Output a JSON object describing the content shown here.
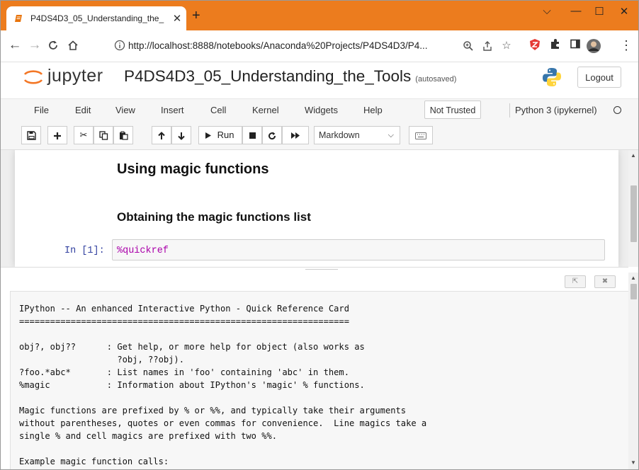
{
  "browser": {
    "tab_title": "P4DS4D3_05_Understanding_the_",
    "new_tab_symbol": "+",
    "url": "http://localhost:8888/notebooks/Anaconda%20Projects/P4DS4D3/P4...",
    "window_controls": [
      "⌵",
      "—",
      "☐",
      "✕"
    ]
  },
  "jupyter": {
    "logo_text": "jupyter",
    "notebook_title": "P4DS4D3_05_Understanding_the_Tools",
    "save_status": "(autosaved)",
    "logout_label": "Logout",
    "menus": [
      "File",
      "Edit",
      "View",
      "Insert",
      "Cell",
      "Kernel",
      "Widgets",
      "Help"
    ],
    "trust_label": "Not Trusted",
    "kernel_name": "Python 3 (ipykernel)"
  },
  "toolbar": {
    "run_label": "Run",
    "cell_type": "Markdown"
  },
  "notebook": {
    "heading2": "Using magic functions",
    "heading3": "Obtaining the magic functions list",
    "cell_prompt": "In [1]:",
    "cell_code": "%quickref"
  },
  "pager": {
    "lines": [
      "IPython -- An enhanced Interactive Python - Quick Reference Card",
      "================================================================",
      "",
      "obj?, obj??      : Get help, or more help for object (also works as",
      "                   ?obj, ??obj).",
      "?foo.*abc*       : List names in 'foo' containing 'abc' in them.",
      "%magic           : Information about IPython's 'magic' % functions.",
      "",
      "Magic functions are prefixed by % or %%, and typically take their arguments",
      "without parentheses, quotes or even commas for convenience.  Line magics take a",
      "single % and cell magics are prefixed with two %%.",
      "",
      "Example magic function calls:"
    ]
  },
  "colors": {
    "chrome_accent": "#ec7c1e",
    "prompt_blue": "#303f9f",
    "magic_purple": "#aa00aa"
  }
}
